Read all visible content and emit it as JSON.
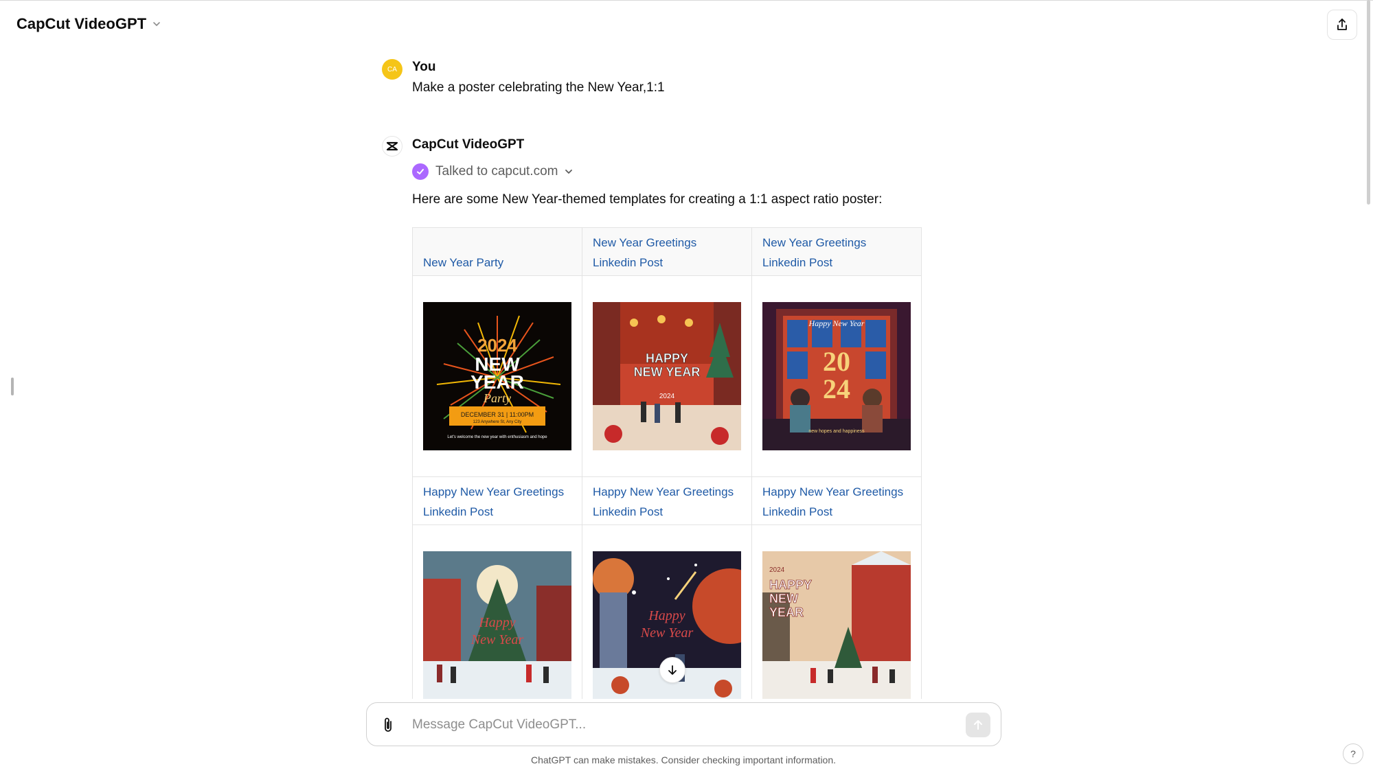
{
  "header": {
    "title": "CapCut VideoGPT"
  },
  "user_message": {
    "avatar_initials": "CA",
    "author": "You",
    "text": "Make a poster celebrating the New Year,1:1"
  },
  "assistant_message": {
    "author": "CapCut VideoGPT",
    "tool_status": "Talked to capcut.com",
    "intro": "Here are some New Year-themed templates for creating a 1:1 aspect ratio poster:",
    "templates_row1": [
      {
        "label": "New Year Party",
        "image": "2024 New Year Party poster with fireworks"
      },
      {
        "label": "New Year Greetings Linkedin Post",
        "image": "Happy New Year street scene with lanterns"
      },
      {
        "label": "New Year Greetings Linkedin Post",
        "image": "2024 window scene with two people"
      }
    ],
    "templates_row2": [
      {
        "label": "Happy New Year Greetings Linkedin Post",
        "image": "Christmas tree town square Happy New Year"
      },
      {
        "label": "Happy New Year Greetings Linkedin Post",
        "image": "Space planets Happy New Year"
      },
      {
        "label": "Happy New Year Greetings Linkedin Post",
        "image": "Snowy village Happy New Year"
      }
    ]
  },
  "composer": {
    "placeholder": "Message CapCut VideoGPT..."
  },
  "footer": {
    "disclaimer": "ChatGPT can make mistakes. Consider checking important information.",
    "help": "?"
  },
  "colors": {
    "link": "#1f5aa6",
    "avatar_user": "#f5c518",
    "check_badge": "#ab68ff"
  },
  "icons": [
    "chevron-down-icon",
    "share-icon",
    "capcut-logo-icon",
    "check-icon",
    "arrow-down-icon",
    "paperclip-icon",
    "arrow-up-icon",
    "help-icon"
  ]
}
